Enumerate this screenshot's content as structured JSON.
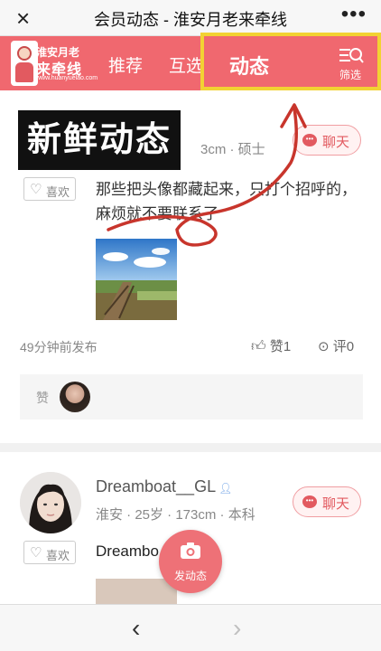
{
  "window": {
    "title": "会员动态 - 淮安月老来牵线",
    "close_icon": "×",
    "more_icon": "•••"
  },
  "nav": {
    "logo_line1": "淮安月老",
    "logo_line2": "来牵线",
    "logo_url": "www.huanyuelao.com",
    "tabs": [
      "推荐",
      "互选",
      "动态"
    ],
    "filter_label": "筛选",
    "accent_color": "#f0686f",
    "highlight_color": "#f2d233"
  },
  "overlay": {
    "title": "新鲜动态"
  },
  "post1": {
    "meta_visible": "3cm · 硕士",
    "chat_label": "聊天",
    "like_label": "喜欢",
    "text": "那些把头像都藏起来，只打个招呼的，麻烦就不要联系了",
    "time": "49分钟前发布",
    "zan_label": "赞",
    "zan_count": "1",
    "ping_label": "评",
    "ping_count": "0",
    "likes_label": "赞"
  },
  "post2": {
    "name": "Dreamboat__GL",
    "meta": "淮安 · 25岁 · 173cm · 本科",
    "chat_label": "聊天",
    "like_label": "喜欢",
    "text": "Dreambo"
  },
  "fab": {
    "label": "发动态"
  },
  "bottom": {
    "back_icon": "‹",
    "forward_icon": "›"
  }
}
